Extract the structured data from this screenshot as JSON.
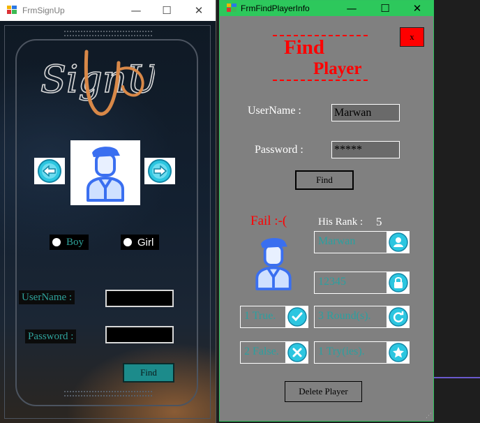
{
  "signup_window": {
    "title": "FrmSignUp",
    "logo_text": "SignUp",
    "gender_options": [
      {
        "label": "Boy",
        "color": "#2fa39c"
      },
      {
        "label": "Girl",
        "color": "#ffffff"
      }
    ],
    "username_label": "UserName :",
    "password_label": "Password :",
    "username_value": "",
    "password_value": "",
    "find_button": "Find"
  },
  "find_window": {
    "title": "FrmFindPlayerInfo",
    "close_label": "x",
    "heading_line1": "Find",
    "heading_line2": "Player",
    "username_label": "UserName :",
    "username_value": "Marwan",
    "password_label": "Password :",
    "password_value": "*****",
    "find_button": "Find",
    "status_text": "Fail :-(",
    "rank_label": "His Rank :",
    "rank_value": "5",
    "player_name": "Marwan",
    "player_password": "12345",
    "true_count": "1 True.",
    "false_count": "2 False.",
    "rounds": "3 Round(s).",
    "tries": "1 Try(ies).",
    "delete_button": "Delete Player"
  },
  "colors": {
    "accent_teal": "#2aa0a0",
    "title_green": "#2dc85c",
    "heading_red": "#ff0000"
  },
  "icons": [
    "app-icon",
    "arrow-left-icon",
    "arrow-right-icon",
    "avatar-icon",
    "user-icon",
    "lock-icon",
    "check-icon",
    "cross-icon",
    "refresh-icon",
    "star-icon"
  ]
}
